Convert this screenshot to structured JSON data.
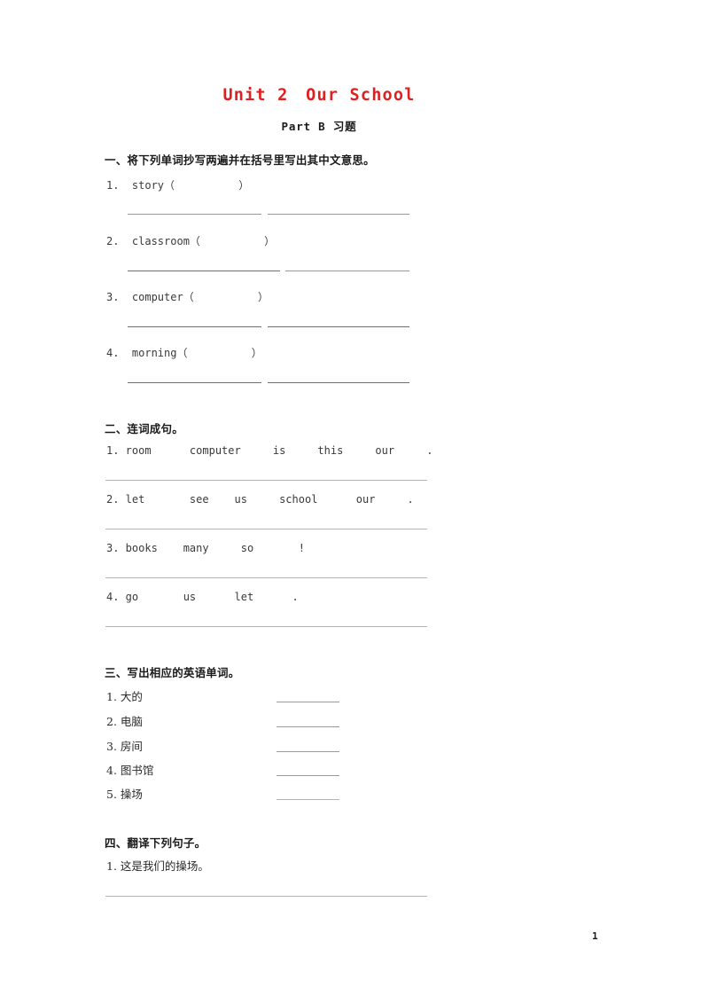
{
  "document": {
    "title": "Unit 2　Our School",
    "subtitle": "Part B 习题",
    "title_color": "#e02020",
    "page_number": "1"
  },
  "sections": [
    {
      "heading": "一、将下列单词抄写两遍并在括号里写出其中文意思。",
      "items": [
        {
          "number": "1.",
          "text": "1.  story（          ）"
        },
        {
          "number": "2.",
          "text": "2.  classroom（          ）"
        },
        {
          "number": "3.",
          "text": "3.  computer（          ）"
        },
        {
          "number": "4.",
          "text": "4.  morning（          ）"
        }
      ]
    },
    {
      "heading": "二、连词成句。",
      "items": [
        {
          "number": "1.",
          "text": "1. room      computer     is     this     our     ."
        },
        {
          "number": "2.",
          "text": "2. let       see    us     school      our     ."
        },
        {
          "number": "3.",
          "text": "3. books    many     so       !"
        },
        {
          "number": "4.",
          "text": "4. go       us      let      ."
        }
      ]
    },
    {
      "heading": "三、写出相应的英语单词。",
      "items": [
        {
          "number": "1.",
          "text": "1. 大的"
        },
        {
          "number": "2.",
          "text": "2. 电脑"
        },
        {
          "number": "3.",
          "text": "3. 房间"
        },
        {
          "number": "4.",
          "text": "4. 图书馆"
        },
        {
          "number": "5.",
          "text": "5. 操场"
        }
      ]
    },
    {
      "heading": "四、翻译下列句子。",
      "items": [
        {
          "number": "1.",
          "text": "1. 这是我们的操场。"
        }
      ]
    }
  ]
}
